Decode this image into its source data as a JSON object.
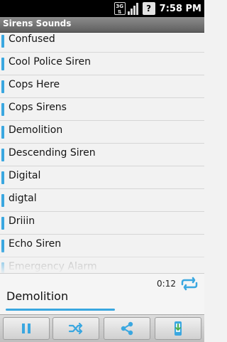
{
  "status_bar": {
    "network": "3G",
    "time": "7:58",
    "time_suffix": "PM",
    "battery_glyph": "?"
  },
  "title_bar": {
    "title": "Sirens Sounds"
  },
  "sound_list": {
    "items": [
      "Confused",
      "Cool Police Siren",
      "Cops Here",
      "Cops Sirens",
      "Demolition",
      "Descending Siren",
      "Digital",
      "digtal",
      "Driiin",
      "Echo Siren",
      "Emergency Alarm"
    ]
  },
  "player": {
    "elapsed": "0:12",
    "now_playing": "Demolition",
    "progress_fraction": 0.55
  },
  "toolbar": {
    "buttons": [
      "pause-icon",
      "shuffle-icon",
      "share-icon",
      "phone-ringtone-icon"
    ]
  },
  "colors": {
    "accent": "#3aa7e0",
    "title_bar": "#6e6e6e",
    "background": "#f2f2f2"
  }
}
